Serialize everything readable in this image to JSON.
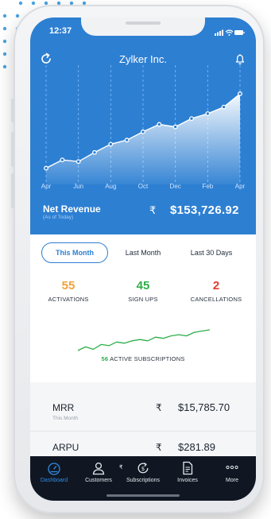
{
  "status": {
    "time": "12:37"
  },
  "header": {
    "title": "Zylker Inc.",
    "refresh_icon": "refresh-icon",
    "bell_icon": "bell-icon"
  },
  "colors": {
    "brand_blue": "#2d7fd2",
    "activations": "#f0a23a",
    "signups": "#2eae4a",
    "cancellations": "#e23b2e",
    "nav_bg": "#101722",
    "nav_active": "#2f8ce6"
  },
  "chart_data": {
    "type": "area",
    "months": [
      "Apr",
      "Jun",
      "Aug",
      "Oct",
      "Dec",
      "Feb",
      "Apr"
    ],
    "point_count": 13,
    "values": [
      10,
      20,
      18,
      29,
      39,
      44,
      54,
      63,
      60,
      70,
      76,
      84,
      100
    ],
    "grid": "vertical-dashed"
  },
  "net_revenue": {
    "label": "Net Revenue",
    "sub": "(As of Today)",
    "currency": "₹",
    "value": "$153,726.92"
  },
  "tabs": [
    {
      "label": "This Month",
      "active": true
    },
    {
      "label": "Last Month",
      "active": false
    },
    {
      "label": "Last 30 Days",
      "active": false
    }
  ],
  "stats": [
    {
      "value": "55",
      "label": "ACTIVATIONS"
    },
    {
      "value": "45",
      "label": "SIGN UPS"
    },
    {
      "value": "2",
      "label": "CANCELLATIONS"
    }
  ],
  "active_subscriptions": {
    "count": "56",
    "label": "ACTIVE SUBSCRIPTIONS",
    "trend": [
      4,
      7,
      5,
      9,
      8,
      11,
      10,
      12,
      13,
      12,
      15,
      14,
      16,
      17,
      16,
      19,
      20,
      21
    ]
  },
  "metrics": [
    {
      "name": "MRR",
      "sub": "This Month",
      "currency": "₹",
      "value": "$15,785.70"
    },
    {
      "name": "ARPU",
      "sub": "",
      "currency": "₹",
      "value": "$281.89"
    }
  ],
  "nav": {
    "items": [
      {
        "label": "Dashboard",
        "icon": "gauge-icon",
        "active": true
      },
      {
        "label": "Customers",
        "icon": "person-icon",
        "active": false
      },
      {
        "label": "Subscriptions",
        "icon": "subscriptions-icon",
        "active": false
      },
      {
        "label": "Invoices",
        "icon": "invoice-icon",
        "active": false
      },
      {
        "label": "More",
        "icon": "more-icon",
        "active": false
      }
    ],
    "currency_symbol": "₹"
  }
}
